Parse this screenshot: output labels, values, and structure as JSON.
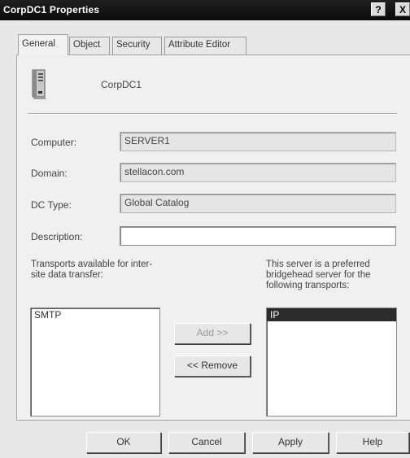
{
  "window": {
    "title": "CorpDC1 Properties",
    "help_label": "?",
    "close_label": "X"
  },
  "tabs": [
    {
      "label": "General",
      "active": true
    },
    {
      "label": "Object"
    },
    {
      "label": "Security"
    },
    {
      "label": "Attribute Editor"
    }
  ],
  "server": {
    "icon": "server-icon",
    "name": "CorpDC1"
  },
  "fields": {
    "computer": {
      "label": "Computer:",
      "value": "SERVER1"
    },
    "domain": {
      "label": "Domain:",
      "value": "stellacon.com"
    },
    "dc_type": {
      "label": "DC Type:",
      "value": "Global Catalog"
    },
    "description": {
      "label": "Description:",
      "value": ""
    }
  },
  "transports": {
    "available_label": "Transports available for inter-site data transfer:",
    "available_items": [
      "SMTP"
    ],
    "preferred_label": "This server is a preferred bridgehead server for the following transports:",
    "preferred_items": [
      "IP"
    ],
    "add_label": "Add >>",
    "remove_label": "<< Remove"
  },
  "footer": {
    "ok": "OK",
    "cancel": "Cancel",
    "apply": "Apply",
    "help": "Help"
  }
}
